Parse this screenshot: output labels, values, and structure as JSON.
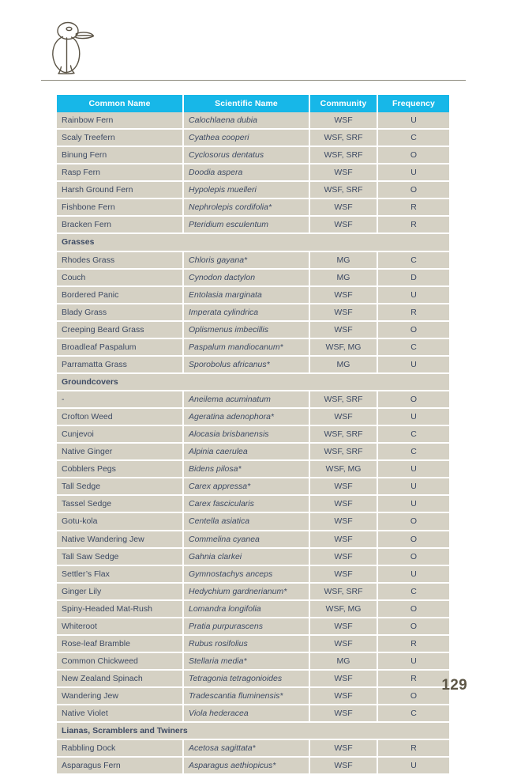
{
  "page": {
    "number": "129",
    "logo_icon": "bird-logo-icon"
  },
  "table": {
    "columns": [
      {
        "key": "common",
        "label": "Common Name"
      },
      {
        "key": "scientific",
        "label": "Scientific Name"
      },
      {
        "key": "community",
        "label": "Community"
      },
      {
        "key": "frequency",
        "label": "Frequency"
      }
    ],
    "colors": {
      "header_background": "#17b7e8",
      "header_text": "#ffffff",
      "row_background": "#d5d1c4",
      "row_text": "#3d4a63",
      "section_background": "#6d6344",
      "section_text": "#ffffff",
      "rule": "#8d8a7d",
      "page_number_text": "#5d5646"
    },
    "rows": [
      {
        "type": "data",
        "common": "Rainbow Fern",
        "scientific": "Calochlaena dubia",
        "community": "WSF",
        "frequency": "U"
      },
      {
        "type": "data",
        "common": "Scaly Treefern",
        "scientific": "Cyathea cooperi",
        "community": "WSF, SRF",
        "frequency": "C"
      },
      {
        "type": "data",
        "common": "Binung Fern",
        "scientific": "Cyclosorus dentatus",
        "community": "WSF, SRF",
        "frequency": "O"
      },
      {
        "type": "data",
        "common": "Rasp Fern",
        "scientific": "Doodia aspera",
        "community": "WSF",
        "frequency": "U"
      },
      {
        "type": "data",
        "common": "Harsh Ground Fern",
        "scientific": "Hypolepis muelleri",
        "community": "WSF, SRF",
        "frequency": "O"
      },
      {
        "type": "data",
        "common": "Fishbone Fern",
        "scientific": "Nephrolepis cordifolia*",
        "community": "WSF",
        "frequency": "R"
      },
      {
        "type": "data",
        "common": "Bracken Fern",
        "scientific": "Pteridium esculentum",
        "community": "WSF",
        "frequency": "R"
      },
      {
        "type": "section",
        "label": "Grasses"
      },
      {
        "type": "data",
        "common": "Rhodes Grass",
        "scientific": "Chloris gayana*",
        "community": "MG",
        "frequency": "C"
      },
      {
        "type": "data",
        "common": "Couch",
        "scientific": "Cynodon dactylon",
        "community": "MG",
        "frequency": "D"
      },
      {
        "type": "data",
        "common": "Bordered Panic",
        "scientific": "Entolasia marginata",
        "community": "WSF",
        "frequency": "U"
      },
      {
        "type": "data",
        "common": "Blady Grass",
        "scientific": "Imperata cylindrica",
        "community": "WSF",
        "frequency": "R"
      },
      {
        "type": "data",
        "common": "Creeping Beard Grass",
        "scientific": "Oplismenus imbecillis",
        "community": "WSF",
        "frequency": "O"
      },
      {
        "type": "data",
        "common": "Broadleaf Paspalum",
        "scientific": "Paspalum mandiocanum*",
        "community": "WSF, MG",
        "frequency": "C"
      },
      {
        "type": "data",
        "common": "Parramatta Grass",
        "scientific": "Sporobolus africanus*",
        "community": "MG",
        "frequency": "U"
      },
      {
        "type": "section",
        "label": "Groundcovers"
      },
      {
        "type": "data",
        "common": "-",
        "scientific": "Aneilema acuminatum",
        "community": "WSF, SRF",
        "frequency": "O"
      },
      {
        "type": "data",
        "common": "Crofton Weed",
        "scientific": "Ageratina adenophora*",
        "community": "WSF",
        "frequency": "U"
      },
      {
        "type": "data",
        "common": "Cunjevoi",
        "scientific": "Alocasia brisbanensis",
        "community": "WSF, SRF",
        "frequency": "C"
      },
      {
        "type": "data",
        "common": "Native Ginger",
        "scientific": "Alpinia caerulea",
        "community": "WSF, SRF",
        "frequency": "C"
      },
      {
        "type": "data",
        "common": "Cobblers Pegs",
        "scientific": "Bidens pilosa*",
        "community": "WSF, MG",
        "frequency": "U"
      },
      {
        "type": "data",
        "common": "Tall Sedge",
        "scientific": "Carex appressa*",
        "community": "WSF",
        "frequency": "U"
      },
      {
        "type": "data",
        "common": "Tassel Sedge",
        "scientific": "Carex fascicularis",
        "community": "WSF",
        "frequency": "U"
      },
      {
        "type": "data",
        "common": "Gotu-kola",
        "scientific": "Centella asiatica",
        "community": "WSF",
        "frequency": "O"
      },
      {
        "type": "data",
        "common": "Native Wandering Jew",
        "scientific": "Commelina cyanea",
        "community": "WSF",
        "frequency": "O"
      },
      {
        "type": "data",
        "common": "Tall Saw Sedge",
        "scientific": "Gahnia clarkei",
        "community": "WSF",
        "frequency": "O"
      },
      {
        "type": "data",
        "common": "Settler’s Flax",
        "scientific": "Gymnostachys anceps",
        "community": "WSF",
        "frequency": "U"
      },
      {
        "type": "data",
        "common": "Ginger Lily",
        "scientific": "Hedychium gardnerianum*",
        "community": "WSF, SRF",
        "frequency": "C"
      },
      {
        "type": "data",
        "common": "Spiny-Headed Mat-Rush",
        "scientific": "Lomandra longifolia",
        "community": "WSF, MG",
        "frequency": "O"
      },
      {
        "type": "data",
        "common": "Whiteroot",
        "scientific": "Pratia purpurascens",
        "community": "WSF",
        "frequency": "O"
      },
      {
        "type": "data",
        "common": "Rose-leaf Bramble",
        "scientific": "Rubus rosifolius",
        "community": "WSF",
        "frequency": "R"
      },
      {
        "type": "data",
        "common": "Common Chickweed",
        "scientific": "Stellaria media*",
        "community": "MG",
        "frequency": "U"
      },
      {
        "type": "data",
        "common": "New Zealand Spinach",
        "scientific": "Tetragonia tetragonioides",
        "community": "WSF",
        "frequency": "R"
      },
      {
        "type": "data",
        "common": "Wandering Jew",
        "scientific": "Tradescantia fluminensis*",
        "community": "WSF",
        "frequency": "O"
      },
      {
        "type": "data",
        "common": "Native Violet",
        "scientific": "Viola hederacea",
        "community": "WSF",
        "frequency": "C"
      },
      {
        "type": "section",
        "label": "Lianas, Scramblers and Twiners"
      },
      {
        "type": "data",
        "common": "Rabbling Dock",
        "scientific": "Acetosa sagittata*",
        "community": "WSF",
        "frequency": "R"
      },
      {
        "type": "data",
        "common": "Asparagus Fern",
        "scientific": "Asparagus aethiopicus*",
        "community": "WSF",
        "frequency": "U"
      }
    ]
  }
}
